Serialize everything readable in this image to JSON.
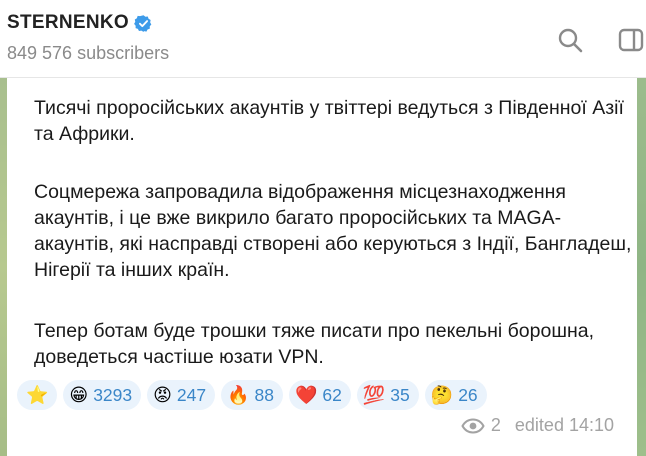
{
  "header": {
    "channel_name": "STERNENKO",
    "subscribers": "849 576 subscribers"
  },
  "message": {
    "paragraph1": "Тисячі проросійських акаунтів у твіттері ведуться з Південної Азії та Африки.",
    "paragraph2": "Соцмережа запровадила відображення місцезнаходження акаунтів, і це вже викрило багато проросійських та MAGA-акаунтів, які насправді створені або керуються з Індії, Бангладеш, Нігерії та інших країн.",
    "paragraph3": "Тепер ботам буде трошки тяже писати про пекельні борошна, доведеться частіше юзати VPN.",
    "reactions": [
      {
        "emoji": "⭐",
        "count": ""
      },
      {
        "emoji": "😁",
        "count": "3293"
      },
      {
        "emoji": "😡",
        "count": "247"
      },
      {
        "emoji": "🔥",
        "count": "88"
      },
      {
        "emoji": "❤️",
        "count": "62"
      },
      {
        "emoji": "💯",
        "count": "35"
      },
      {
        "emoji": "🤔",
        "count": "26"
      }
    ],
    "views": "2",
    "edited": "edited 14:10"
  },
  "icons": {
    "verified": "verified-badge-icon",
    "search": "search-icon",
    "sidebar": "sidebar-toggle-icon",
    "views": "eye-icon"
  },
  "colors": {
    "accent": "#3a86c8",
    "verified": "#3d9be9",
    "reaction_bg": "#eaf3fc",
    "meta_text": "#a3a3a3"
  }
}
